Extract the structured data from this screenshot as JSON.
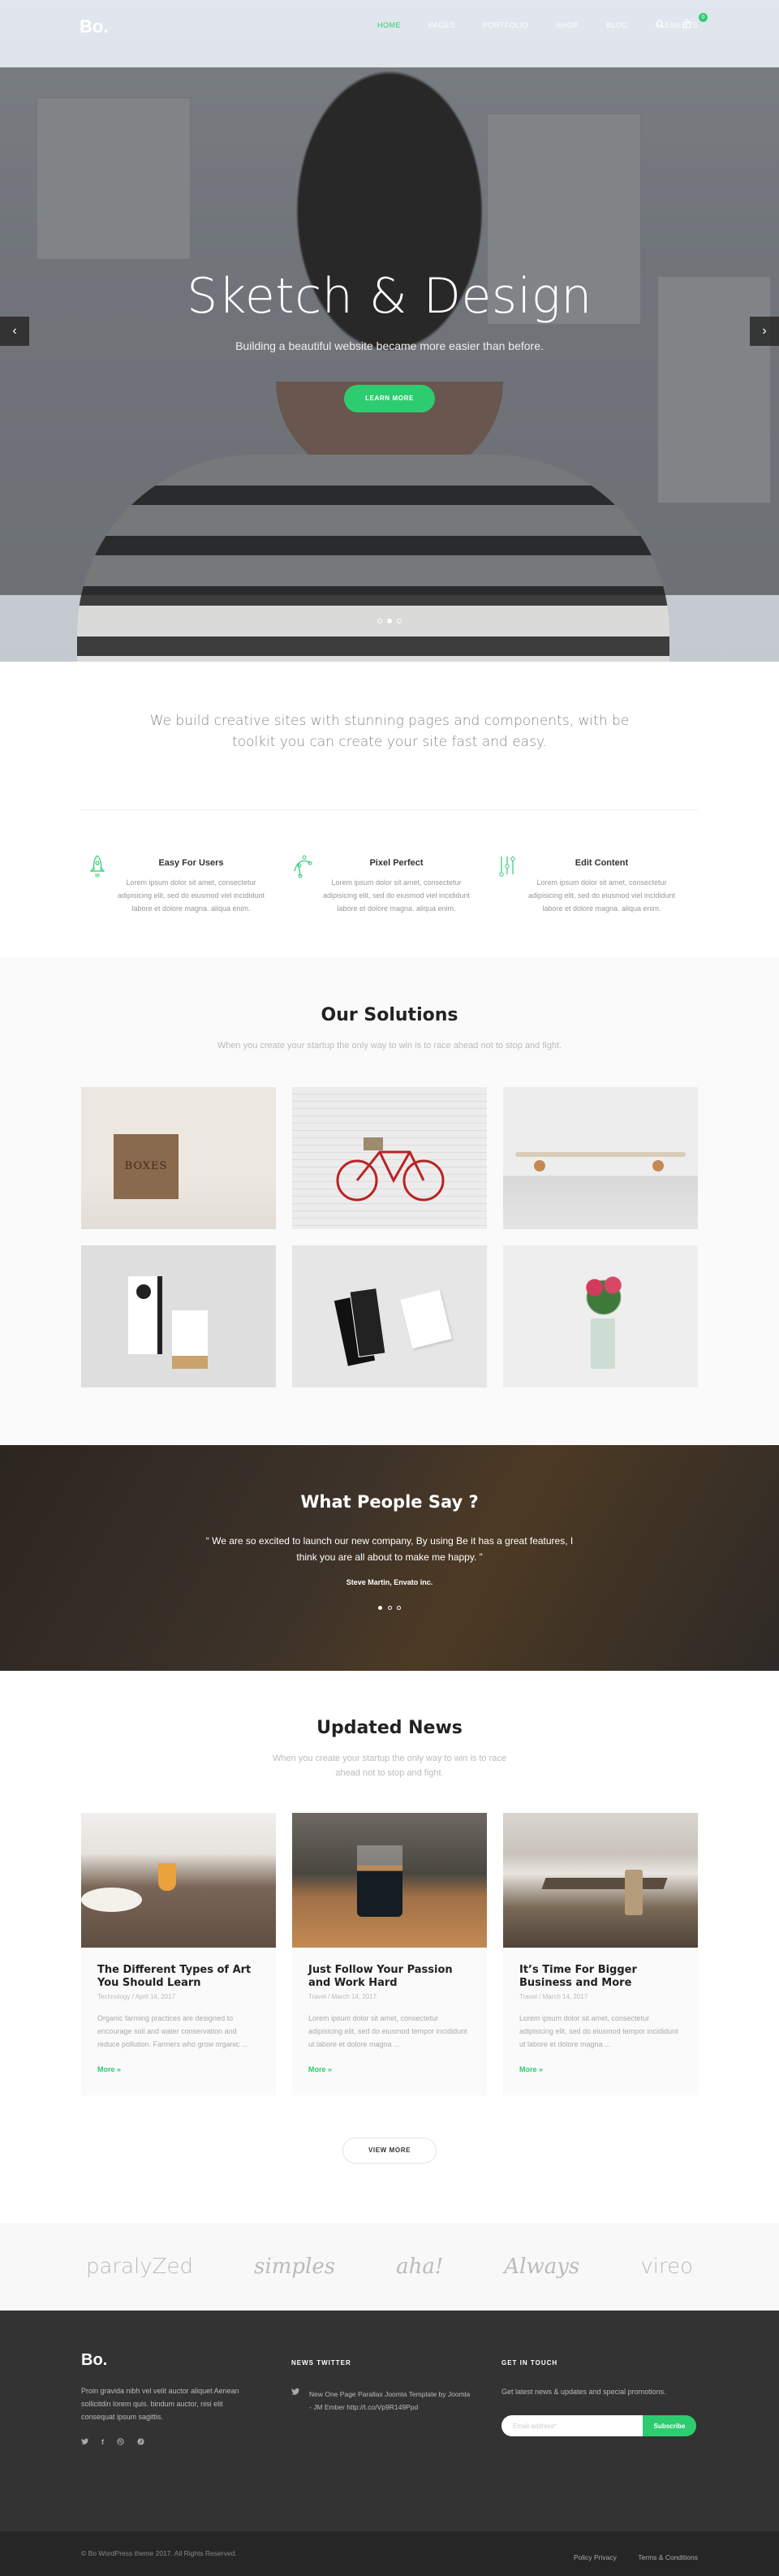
{
  "brand": {
    "logo": "Bo.",
    "accent": "#2ecc71"
  },
  "nav": {
    "items": [
      {
        "label": "HOME",
        "active": true
      },
      {
        "label": "PAGES"
      },
      {
        "label": "PORTFOLIO"
      },
      {
        "label": "SHOP"
      },
      {
        "label": "BLOG"
      },
      {
        "label": "ELEMENTS"
      }
    ],
    "search_icon": "search-icon",
    "cart_icon": "cart-icon",
    "cart_count": "0"
  },
  "hero": {
    "title": "Sketch & Design",
    "subtitle": "Building a beautiful website became more easier than before.",
    "button": "LEARN MORE",
    "prev_icon": "‹",
    "next_icon": "›",
    "slides": 3,
    "active_slide": 2
  },
  "intro": {
    "text": "We build creative sites with stunning pages and components, with be toolkit you can create your site fast and easy."
  },
  "features": [
    {
      "icon": "rocket-icon",
      "title": "Easy For Users",
      "text": "Lorem ipsum dolor sit amet, consectetur adipisicing elit, sed do eiusmod viel incididunt labore et dolore magna. aliqua enim."
    },
    {
      "icon": "bezier-curve-icon",
      "title": "Pixel Perfect",
      "text": "Lorem ipsum dolor sit amet, consectetur adipisicing elit, sed do eiusmod viel incididunt labore et dolore magna. aliqua enim."
    },
    {
      "icon": "sliders-icon",
      "title": "Edit Content",
      "text": "Lorem ipsum dolor sit amet, consectetur adipisicing elit, sed do eiusmod viel incididunt labore et dolore magna. aliqua enim."
    }
  ],
  "solutions": {
    "title": "Our Solutions",
    "subtitle": "When you create your startup the only way to win is to race ahead not to stop and fight.",
    "items": [
      "wooden-boxes-image",
      "red-bicycle-image",
      "skateboard-image",
      "packaging-boxes-image",
      "business-cards-image",
      "flower-vase-image"
    ],
    "box_label": "BOXES"
  },
  "testimonial": {
    "title": "What People Say ?",
    "quote": "“ We are so excited to launch our new company, By using Be it has a great features, I think you are all about to make me happy. ”",
    "author": "Steve Martin, Envato inc.",
    "slides": 3,
    "active_slide": 1
  },
  "news": {
    "title": "Updated News",
    "subtitle": "When you create your startup the only way to win is to race ahead not to stop and fight.",
    "posts": [
      {
        "image": "breakfast-image",
        "title": "The Different Types of Art You Should Learn",
        "category": "Technology",
        "date": "April 14, 2017",
        "excerpt": "Organic farming practices are designed to encourage soil and water conservation and reduce pollution. Farmers who grow organic ...",
        "more": "More »"
      },
      {
        "image": "coffee-glass-image",
        "title": "Just Follow Your Passion and Work Hard",
        "category": "Travel",
        "date": "March 14, 2017",
        "excerpt": "Lorem ipsum dolor sit amet, consectetur adipisicing elit, sed do eiusmod tempor incididunt ut labore et dolore magna ...",
        "more": "More »"
      },
      {
        "image": "conference-room-image",
        "title": "It’s Time For Bigger Business and More",
        "category": "Travel",
        "date": "March 14, 2017",
        "excerpt": "Lorem ipsum dolor sit amet, consectetur adipisicing elit, sed do eiusmod tempor incididunt ut labore et dolore magna ...",
        "more": "More »"
      }
    ],
    "meta_separator": " / ",
    "view_more": "VIEW MORE"
  },
  "clients": [
    "paralyZed",
    "simples",
    "aha!",
    "Always",
    "vireo"
  ],
  "footer": {
    "logo": "Bo.",
    "about": "Proin gravida nibh vel velit auctor aliquet Aenean sollicitdin lorem quis. bindum auctor, nisi elit consequat ipsum sagittis.",
    "social": [
      "twitter-icon",
      "facebook-icon",
      "dribbble-icon",
      "pinterest-icon"
    ],
    "twitter_heading": "NEWS TWITTER",
    "tweet": "New One Page Parallax Joomla Template by Joomla - JM Ember http://t.co/Vp9R149Ppd",
    "contact_heading": "GET IN TOUCH",
    "promo": "Get latest news & updates and special promotions.",
    "email_placeholder": "Email address*",
    "subscribe": "Subscribe",
    "copyright": "© Bo WordPress theme 2017. All Rights Reserved.",
    "links": [
      "Policy Privacy",
      "Terms & Conditions"
    ]
  }
}
